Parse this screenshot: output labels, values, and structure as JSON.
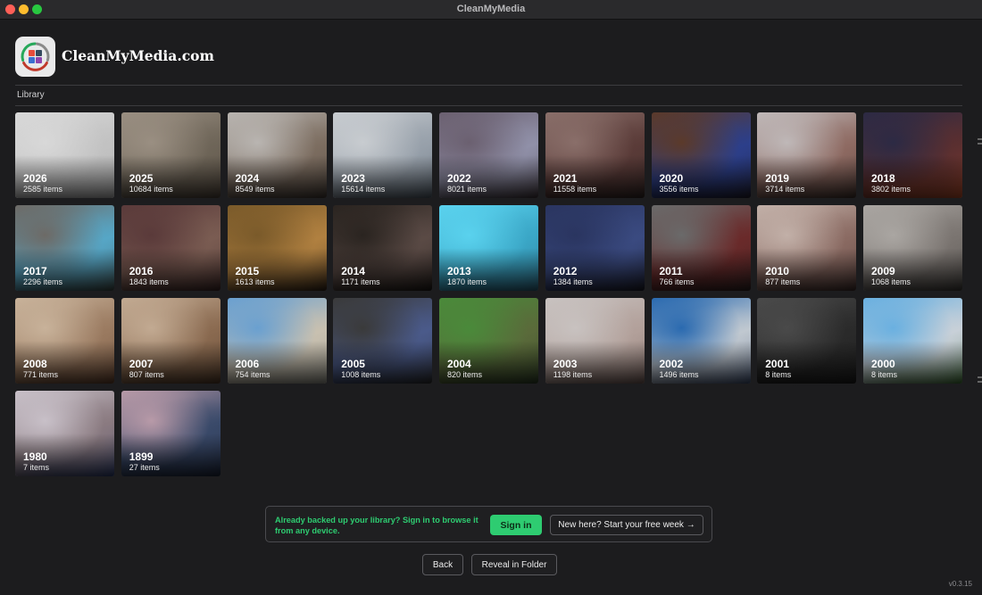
{
  "window": {
    "title": "CleanMyMedia"
  },
  "brand": {
    "name": "CleanMyMedia.com"
  },
  "library": {
    "label": "Library",
    "years": [
      {
        "year": "2026",
        "count": "2585 items",
        "colors": [
          "#d8d8d8",
          "#c2c2c2",
          "#a9a9a9"
        ]
      },
      {
        "year": "2025",
        "count": "10684 items",
        "colors": [
          "#9a8f82",
          "#6e6558",
          "#4a4036"
        ]
      },
      {
        "year": "2024",
        "count": "8549 items",
        "colors": [
          "#b9b5b1",
          "#7c6d60",
          "#3d3530"
        ]
      },
      {
        "year": "2023",
        "count": "15614 items",
        "colors": [
          "#c8ccd0",
          "#97a0aa",
          "#4a5560"
        ]
      },
      {
        "year": "2022",
        "count": "8021 items",
        "colors": [
          "#6b6070",
          "#9090a8",
          "#3a3035"
        ]
      },
      {
        "year": "2021",
        "count": "11558 items",
        "colors": [
          "#8a6f6a",
          "#5a3b38",
          "#2d2322"
        ]
      },
      {
        "year": "2020",
        "count": "3556 items",
        "colors": [
          "#5b3a2a",
          "#2c3f8a",
          "#1f1c2a"
        ]
      },
      {
        "year": "2019",
        "count": "3714 items",
        "colors": [
          "#bfb8b8",
          "#8e6a62",
          "#3a2d28"
        ]
      },
      {
        "year": "2018",
        "count": "3802 items",
        "colors": [
          "#2c2a44",
          "#5a2f30",
          "#b04a28"
        ]
      },
      {
        "year": "2017",
        "count": "2296 items",
        "colors": [
          "#6d6a66",
          "#56a6c6",
          "#3a4540"
        ]
      },
      {
        "year": "2016",
        "count": "1843 items",
        "colors": [
          "#5a3a3a",
          "#7a5c52",
          "#3a2525"
        ]
      },
      {
        "year": "2015",
        "count": "1613 items",
        "colors": [
          "#7a5a2a",
          "#b08040",
          "#2d2015"
        ]
      },
      {
        "year": "2014",
        "count": "1171 items",
        "colors": [
          "#2a2420",
          "#5a4a45",
          "#1c1815"
        ]
      },
      {
        "year": "2013",
        "count": "1870 items",
        "colors": [
          "#5ad2ee",
          "#3aa6c6",
          "#2a5a70"
        ]
      },
      {
        "year": "2012",
        "count": "1384 items",
        "colors": [
          "#2a3560",
          "#3a4a80",
          "#1a1a25"
        ]
      },
      {
        "year": "2011",
        "count": "766 items",
        "colors": [
          "#6a6a6a",
          "#6a2a2a",
          "#2a2020"
        ]
      },
      {
        "year": "2010",
        "count": "877 items",
        "colors": [
          "#c2b0a8",
          "#8a6a62",
          "#3a2a28"
        ]
      },
      {
        "year": "2009",
        "count": "1068 items",
        "colors": [
          "#aaa6a2",
          "#7a7470",
          "#3a3835"
        ]
      },
      {
        "year": "2008",
        "count": "771 items",
        "colors": [
          "#c8b29a",
          "#9a7a60",
          "#5a3a28"
        ]
      },
      {
        "year": "2007",
        "count": "807 items",
        "colors": [
          "#c2aa92",
          "#8a6a50",
          "#4a3525"
        ]
      },
      {
        "year": "2006",
        "count": "754 items",
        "colors": [
          "#6aa0d0",
          "#c8c0b0",
          "#8a8a80"
        ]
      },
      {
        "year": "2005",
        "count": "1008 items",
        "colors": [
          "#3a3a3a",
          "#4a5a8a",
          "#2a2a2a"
        ]
      },
      {
        "year": "2004",
        "count": "820 items",
        "colors": [
          "#4a8a3a",
          "#5a6a3a",
          "#2a3a25"
        ]
      },
      {
        "year": "2003",
        "count": "1198 items",
        "colors": [
          "#c8c2c0",
          "#b2a09a",
          "#6a5550"
        ]
      },
      {
        "year": "2002",
        "count": "1496 items",
        "colors": [
          "#2a6ab0",
          "#c0c8d0",
          "#3a4a6a"
        ]
      },
      {
        "year": "2001",
        "count": "8 items",
        "colors": [
          "#4a4a4a",
          "#2a2a2a",
          "#1a1a1a"
        ]
      },
      {
        "year": "2000",
        "count": "8 items",
        "colors": [
          "#6ab0e0",
          "#c8d0d8",
          "#3a6a30"
        ]
      },
      {
        "year": "1980",
        "count": "7 items",
        "colors": [
          "#c8c0c8",
          "#8a7a80",
          "#2a3a6a"
        ]
      },
      {
        "year": "1899",
        "count": "27 items",
        "colors": [
          "#b89aa8",
          "#3a4a6a",
          "#1a2235"
        ]
      }
    ]
  },
  "signin": {
    "message": "Already backed up your library? Sign in to browse it from any device.",
    "signin_label": "Sign in",
    "trial_label": "New here? Start your free week →"
  },
  "footer": {
    "back_label": "Back",
    "reveal_label": "Reveal in Folder",
    "version": "v0.3.15"
  },
  "colors": {
    "accent": "#2ecc71",
    "background": "#1c1c1e"
  },
  "icons": [
    "app-logo-icon"
  ]
}
